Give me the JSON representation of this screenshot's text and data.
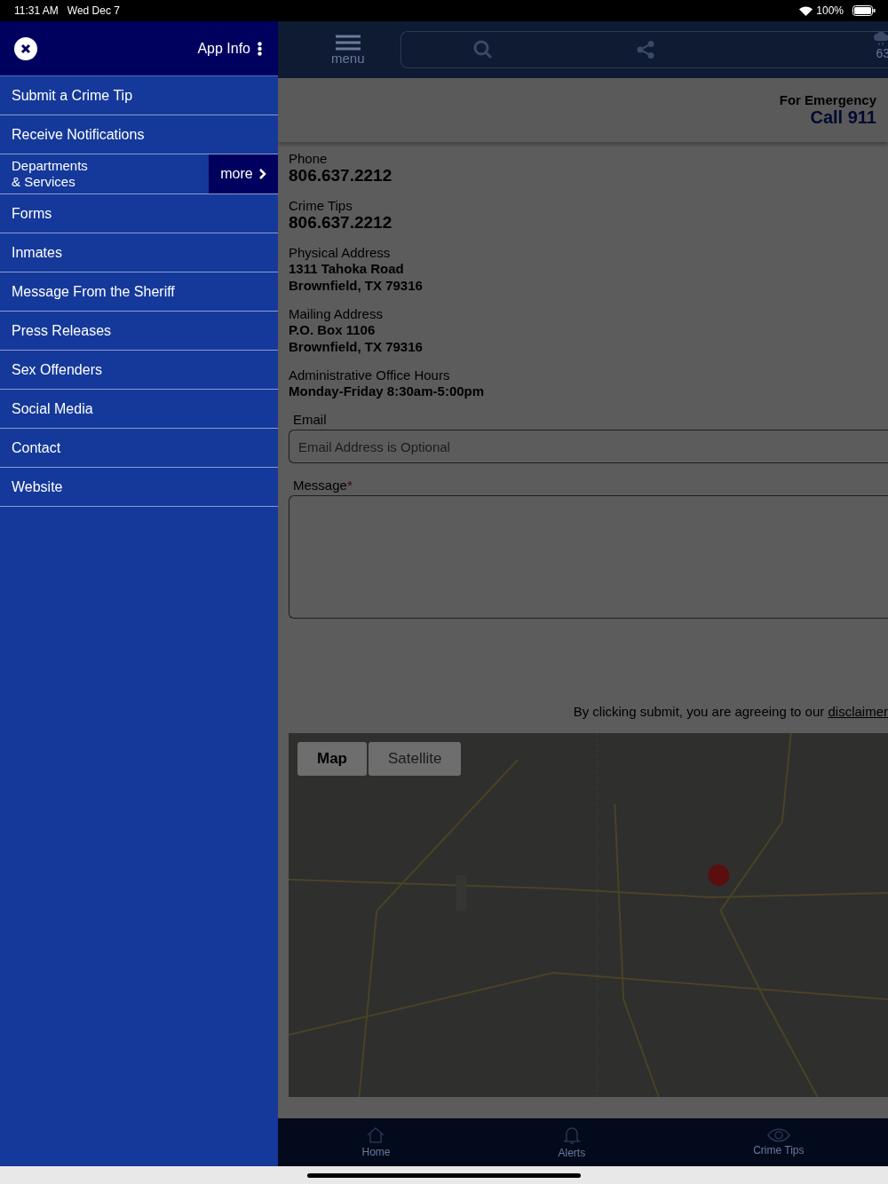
{
  "status_bar": {
    "time": "11:31 AM",
    "date": "Wed Dec 7",
    "battery": "100%"
  },
  "drawer": {
    "title": "App Info",
    "items": [
      {
        "label": "Submit a Crime Tip"
      },
      {
        "label": "Receive Notifications"
      },
      {
        "label": "Departments\n& Services",
        "more": "more"
      },
      {
        "label": "Forms"
      },
      {
        "label": "Inmates"
      },
      {
        "label": "Message From the Sheriff"
      },
      {
        "label": "Press Releases"
      },
      {
        "label": "Sex Offenders"
      },
      {
        "label": "Social Media"
      },
      {
        "label": "Contact"
      },
      {
        "label": "Website"
      }
    ]
  },
  "top_bar": {
    "menu_label": "menu",
    "weather": "63"
  },
  "emergency": {
    "label": "For Emergency",
    "call": "Call 911"
  },
  "info": [
    {
      "kind": "phone",
      "label": "Phone",
      "value": "806.637.2212"
    },
    {
      "kind": "phone",
      "label": "Crime Tips",
      "value": "806.637.2212"
    },
    {
      "kind": "text",
      "label": "Physical Address",
      "value": "1311 Tahoka Road\nBrownfield, TX 79316"
    },
    {
      "kind": "text",
      "label": "Mailing Address",
      "value": "P.O. Box 1106\nBrownfield, TX 79316"
    },
    {
      "kind": "text",
      "label": "Administrative Office Hours",
      "value": "Monday-Friday 8:30am-5:00pm"
    }
  ],
  "form": {
    "email_label": "Email",
    "email_placeholder": "Email Address is Optional",
    "message_label": "Message",
    "required_mark": "*"
  },
  "disclaimer": {
    "text": "By clicking submit, you are agreeing to our",
    "link": "disclaimer"
  },
  "map": {
    "tabs": [
      {
        "label": "Map",
        "selected": true
      },
      {
        "label": "Satellite",
        "selected": false
      }
    ]
  },
  "bottom_nav": [
    {
      "kind": "home",
      "label": "Home"
    },
    {
      "kind": "bell",
      "label": "Alerts"
    },
    {
      "kind": "eye",
      "label": "Crime Tips"
    }
  ]
}
